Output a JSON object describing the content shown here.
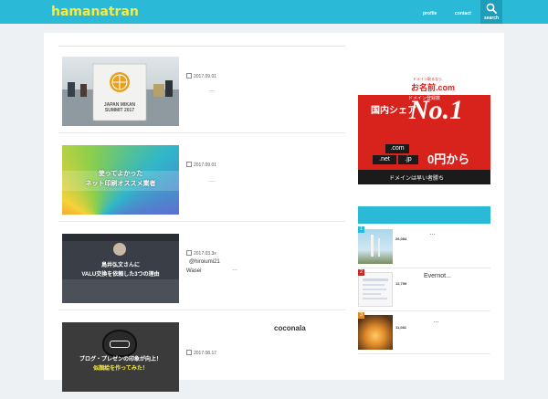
{
  "header": {
    "logo": "hamanatran",
    "nav": [
      {
        "label": "profile"
      },
      {
        "label": "contact"
      }
    ],
    "search_label": "search"
  },
  "articles": [
    {
      "date": "2017.09.01",
      "excerpt": "…",
      "thumb_text": [
        "JAPAN MIKAN",
        "SUMMIT 2017"
      ]
    },
    {
      "date": "2017.09.01",
      "excerpt": "…",
      "thumb_text": [
        "使ってよかった",
        "ネット印刷オススメ業者"
      ]
    },
    {
      "date": "2017.03.3x",
      "author": "@hiroiumi21",
      "source": "Wasei",
      "excerpt": "…",
      "thumb_text": [
        "鳥井弘文さんに",
        "VALU交換を依頼した3つの理由"
      ]
    },
    {
      "date": "2017.08.17",
      "heading": "coconala",
      "thumb_text": [
        "ブログ・プレゼンの印象が向上！",
        "似顔絵を作ってみた！"
      ]
    }
  ],
  "ad": {
    "tagline": "ドメイン取るなら",
    "brand": "お名前.com",
    "subtitle": "ドメイン登録数",
    "share": "国内シェア",
    "big": "No.1",
    "tld1": ".com",
    "tld2": ".net",
    "tld3": ".jp",
    "price": "0円から",
    "footer": "ドメインは早い者勝ち"
  },
  "ranking": [
    {
      "rank": "1",
      "views": "26,084",
      "title": "…"
    },
    {
      "rank": "2",
      "views": "12,759",
      "title": "Evernot..."
    },
    {
      "rank": "3",
      "views": "11,081",
      "title": "…"
    }
  ],
  "colors": {
    "accent": "#2ab9d6",
    "logo": "#f6ea48",
    "ad_red": "#d8221c"
  }
}
